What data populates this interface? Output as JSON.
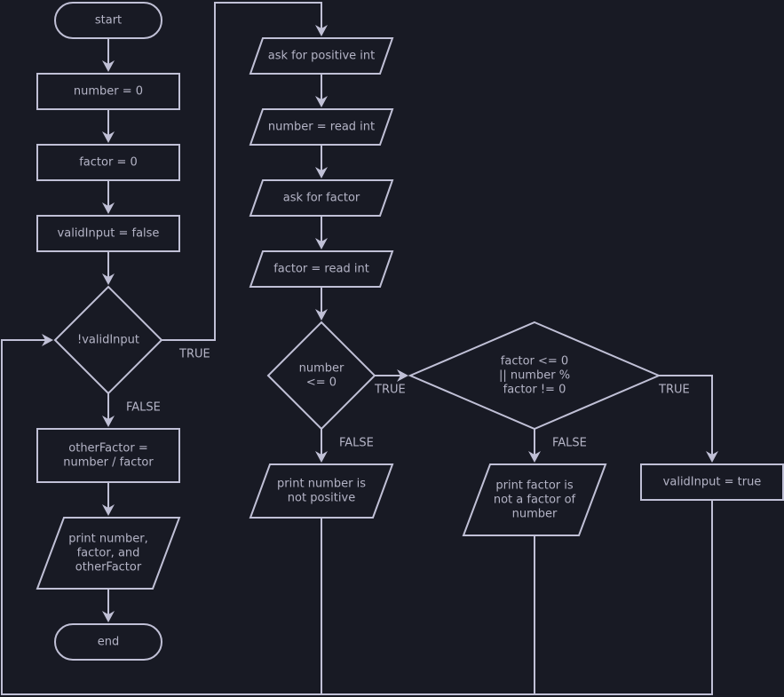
{
  "colors": {
    "background": "#181a24",
    "stroke": "#c0c0d6",
    "text": "#b4b4c6"
  },
  "nodes": {
    "start": {
      "type": "terminal",
      "lines": [
        "start"
      ]
    },
    "number_init": {
      "type": "process",
      "lines": [
        "number = 0"
      ]
    },
    "factor_init": {
      "type": "process",
      "lines": [
        "factor = 0"
      ]
    },
    "valid_init": {
      "type": "process",
      "lines": [
        "validInput = false"
      ]
    },
    "loop_cond": {
      "type": "decision",
      "lines": [
        "!validInput"
      ]
    },
    "other_factor": {
      "type": "process",
      "lines": [
        "otherFactor =",
        "number / factor"
      ]
    },
    "print_result": {
      "type": "io",
      "lines": [
        "print number,",
        "factor, and",
        "otherFactor"
      ]
    },
    "end": {
      "type": "terminal",
      "lines": [
        "end"
      ]
    },
    "ask_positive": {
      "type": "io",
      "lines": [
        "ask for positive int"
      ]
    },
    "read_number": {
      "type": "io",
      "lines": [
        "number = read int"
      ]
    },
    "ask_factor": {
      "type": "io",
      "lines": [
        "ask for factor"
      ]
    },
    "read_factor": {
      "type": "io",
      "lines": [
        "factor = read int"
      ]
    },
    "number_cond": {
      "type": "decision",
      "lines": [
        "number",
        "<= 0"
      ]
    },
    "factor_cond": {
      "type": "decision",
      "lines": [
        "factor <= 0",
        "|| number %",
        "factor != 0"
      ]
    },
    "print_not_positive": {
      "type": "io",
      "lines": [
        "print number is",
        "not positive"
      ]
    },
    "print_not_factor": {
      "type": "io",
      "lines": [
        "print factor is",
        "not a factor of",
        "number"
      ]
    },
    "valid_true": {
      "type": "process",
      "lines": [
        "validInput = true"
      ]
    }
  },
  "edge_labels": {
    "loop_true": "TRUE",
    "loop_false": "FALSE",
    "number_true": "TRUE",
    "number_false": "FALSE",
    "factor_true": "TRUE",
    "factor_false": "FALSE"
  }
}
